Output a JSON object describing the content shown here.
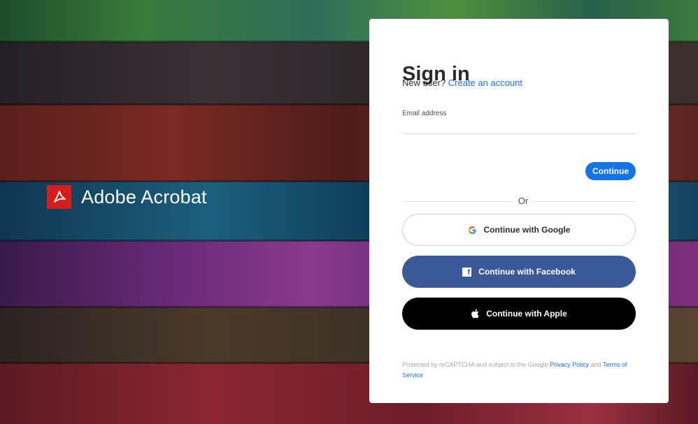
{
  "brand": {
    "name": "Adobe Acrobat",
    "logo_icon": "adobe-acrobat-logo-icon",
    "logo_color": "#d41e1e"
  },
  "signin": {
    "title": "Sign in",
    "new_user_prefix": "New user?",
    "create_account": "Create an account",
    "email_label": "Email address",
    "email_value": "",
    "continue_label": "Continue",
    "or_label": "Or"
  },
  "social": {
    "google": {
      "label": "Continue with Google",
      "icon": "google-icon"
    },
    "facebook": {
      "label": "Continue with Facebook",
      "icon": "facebook-icon"
    },
    "apple": {
      "label": "Continue with Apple",
      "icon": "apple-icon"
    }
  },
  "legal": {
    "prefix": "Protected by reCAPTCHA and subject to the Google",
    "privacy": "Privacy Policy",
    "and": "and",
    "terms": "Terms of Service"
  },
  "colors": {
    "accent": "#1473e6",
    "facebook": "#3b5998",
    "apple": "#000000"
  }
}
